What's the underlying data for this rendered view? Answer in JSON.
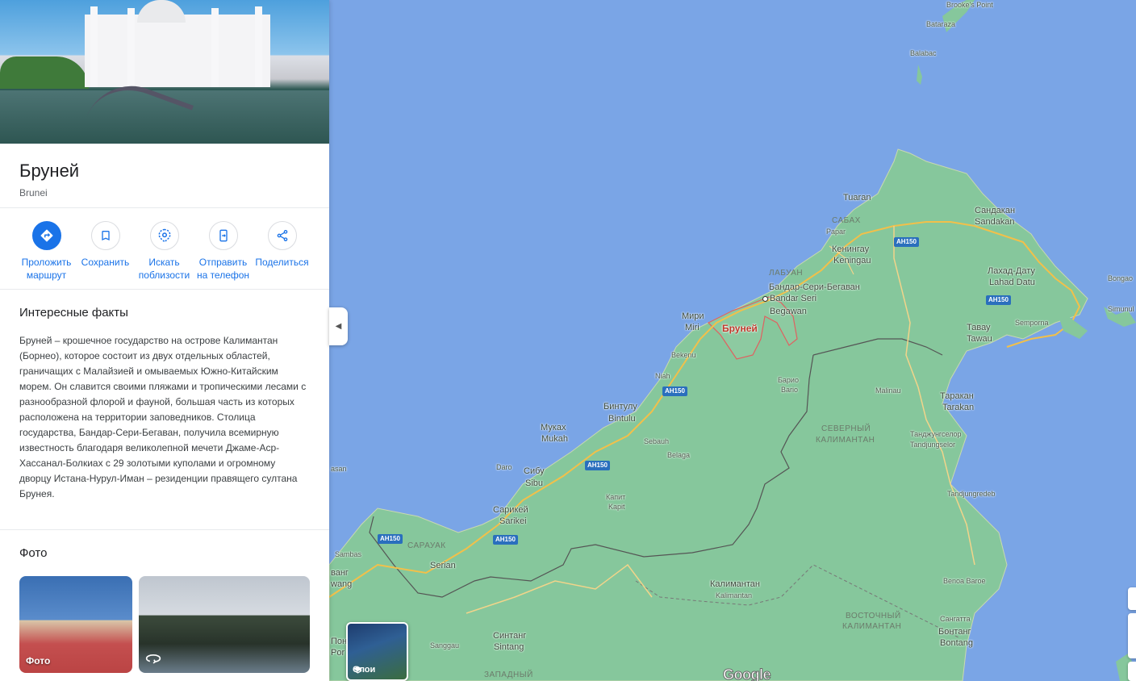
{
  "place": {
    "title": "Бруней",
    "subtitle": "Brunei"
  },
  "actions": [
    {
      "label": "Проложить\nмаршрут",
      "icon": "directions-icon"
    },
    {
      "label": "Сохранить",
      "icon": "bookmark-icon"
    },
    {
      "label": "Искать\nпоблизости",
      "icon": "nearby-icon"
    },
    {
      "label": "Отправить\nна телефон",
      "icon": "send-to-phone-icon"
    },
    {
      "label": "Поделиться",
      "icon": "share-icon"
    }
  ],
  "facts": {
    "title": "Интересные факты",
    "text": "Бруней – крошечное государство на острове Калимантан (Борнео), которое состоит из двух отдельных областей, граничащих с Малайзией и омываемых Южно-Китайским морем. Он славится своими пляжами и тропическими лесами с разнообразной флорой и фауной, большая часть из которых расположена на территории заповедников. Столица государства, Бандар-Сери-Бегаван, получила всемирную известность благодаря великолепной мечети Джаме-Аср-Хассанал-Болкиах с 29 золотыми куполами и огромному дворцу Истана-Нурул-Иман – резиденции правящего султана Брунея."
  },
  "photos": {
    "title": "Фото",
    "items": [
      {
        "caption": "Фото",
        "icon": "photo-icon"
      },
      {
        "caption": "",
        "icon": "360-view-icon"
      }
    ]
  },
  "map": {
    "layers_label": "Слои",
    "logo": "Google",
    "road_shield": "AH150",
    "labels": {
      "brookes_point": "Brooke's Point",
      "bataraza": "Bataraza",
      "balabac": "Balabac",
      "tuaran": "Tuaran",
      "sabah": "САБАХ",
      "papar": "Papar",
      "keningau_ru": "Кенингау",
      "keningau": "Keningau",
      "sandakan_ru": "Сандакан",
      "sandakan": "Sandakan",
      "labuan": "ЛАБУАН",
      "bsb_ru": "Бандар-Сери-Бегаван",
      "bsb_1": "Bandar Seri",
      "bsb_2": "Begawan",
      "lahad_datu_ru": "Лахад-Дату",
      "lahad_datu": "Lahad Datu",
      "bongao": "Bongao",
      "simunul": "Simunul",
      "miri_ru": "Мири",
      "miri": "Miri",
      "brunei": "Бруней",
      "semporna": "Semporna",
      "tawau_ru": "Тавау",
      "tawau": "Tawau",
      "bekenu": "Bekenu",
      "niah": "Niah",
      "bario_ru": "Барио",
      "bario": "Bario",
      "malinau": "Malinau",
      "tarakan_ru": "Таракан",
      "tarakan": "Tarakan",
      "bintulu_ru": "Бинтулу",
      "bintulu": "Bintulu",
      "mukah_ru": "Муках",
      "mukah": "Mukah",
      "north_kalimantan_1": "СЕВЕРНЫЙ",
      "north_kalimantan_2": "КАЛИМАНТАН",
      "tanjung_selor_ru": "Танджунгселор",
      "tanjung_selor": "Tandjungselor",
      "sebauh": "Sebauh",
      "belaga": "Belaga",
      "daro": "Daro",
      "sibu_ru": "Сибу",
      "sibu": "Sibu",
      "tanjungredeb": "Tandjungredeb",
      "kapit_ru": "Капит",
      "kapit": "Kapit",
      "sarikei_ru": "Сарикей",
      "sarikei": "Sarikei",
      "sarawak": "САРАУАК",
      "sambas": "Sambas",
      "serian": "Serian",
      "kalimantan_ru": "Калимантан",
      "kalimantan": "Kalimantan",
      "benoa_baroe": "Benoa Baroe",
      "sangatta_ru": "Сангатта",
      "sangatta": "Sangatta",
      "east_kalimantan_1": "ВОСТОЧНЫЙ",
      "east_kalimantan_2": "КАЛИМАНТАН",
      "bontang_ru": "Бонтанг",
      "bontang": "Bontang",
      "sintang_ru": "Синтанг",
      "sintang": "Sintang",
      "sanggau": "Sanggau",
      "west_kalimantan": "ЗАПАДНЫЙ",
      "asan": "asan",
      "wang_1": "ванг",
      "wang_2": "wang",
      "pon": "Пон",
      "por": "Por"
    }
  }
}
